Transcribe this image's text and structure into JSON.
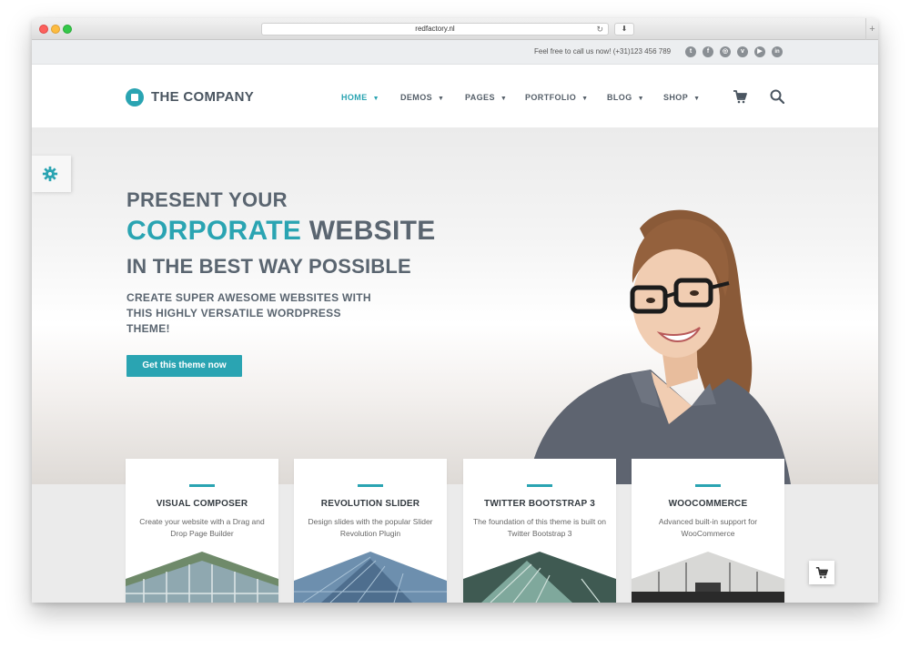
{
  "browser": {
    "url": "redfactory.nl",
    "reload_glyph": "↻",
    "download_glyph": "⬇",
    "new_tab_glyph": "+"
  },
  "topbar": {
    "call_text": "Feel free to call us now! (+31)123 456 789",
    "social_icons": [
      {
        "name": "twitter-icon",
        "glyph": "t"
      },
      {
        "name": "facebook-icon",
        "glyph": "f"
      },
      {
        "name": "instagram-icon",
        "glyph": "◎"
      },
      {
        "name": "vimeo-icon",
        "glyph": "v"
      },
      {
        "name": "youtube-icon",
        "glyph": "▶"
      },
      {
        "name": "linkedin-icon",
        "glyph": "in"
      }
    ]
  },
  "brand": {
    "name": "THE COMPANY",
    "accent_color": "#2aa4b2"
  },
  "nav": {
    "items": [
      {
        "label": "HOME",
        "active": true
      },
      {
        "label": "DEMOS",
        "active": false
      },
      {
        "label": "PAGES",
        "active": false
      },
      {
        "label": "PORTFOLIO",
        "active": false
      },
      {
        "label": "BLOG",
        "active": false
      },
      {
        "label": "SHOP",
        "active": false
      }
    ],
    "chevron": "▼"
  },
  "hero": {
    "line1": "PRESENT YOUR",
    "line2_accent": "CORPORATE",
    "line2_rest": " WEBSITE",
    "line3": "IN THE BEST WAY POSSIBLE",
    "subtitle": "CREATE SUPER AWESOME WEBSITES WITH THIS HIGHLY VERSATILE WORDPRESS THEME!",
    "cta_label": "Get this theme now"
  },
  "features": [
    {
      "title": "VISUAL COMPOSER",
      "description": "Create your website with a Drag and Drop Page Builder"
    },
    {
      "title": "REVOLUTION SLIDER",
      "description": "Design slides with the popular Slider Revolution Plugin"
    },
    {
      "title": "TWITTER BOOTSTRAP 3",
      "description": "The foundation of this theme is built on Twitter Bootstrap 3"
    },
    {
      "title": "WOOCOMMERCE",
      "description": "Advanced built-in support for WooCommerce"
    }
  ]
}
